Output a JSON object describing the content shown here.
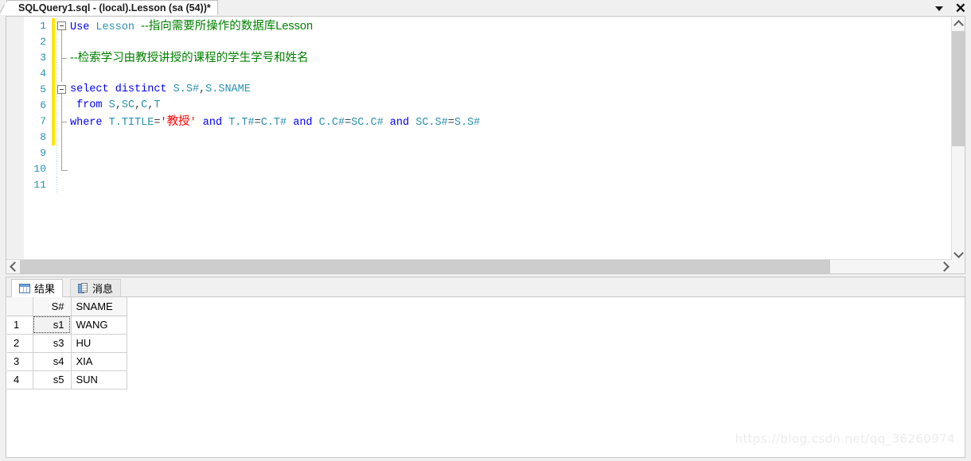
{
  "window": {
    "tab_title": "SQLQuery1.sql - (local).Lesson (sa (54))*",
    "dropdown_icon": "chevron-down-icon",
    "close_icon": "close-icon"
  },
  "editor": {
    "line_numbers": [
      "1",
      "2",
      "3",
      "4",
      "5",
      "6",
      "7",
      "8",
      "9",
      "10",
      "11"
    ],
    "lines": [
      {
        "n": "1",
        "tokens": [
          {
            "t": "Use",
            "c": "kw"
          },
          {
            "t": " ",
            "c": "plain"
          },
          {
            "t": "Lesson",
            "c": "ident"
          },
          {
            "t": " ",
            "c": "plain"
          },
          {
            "t": "--指向需要所操作的数据库Lesson",
            "c": "cmt"
          }
        ]
      },
      {
        "n": "2",
        "tokens": []
      },
      {
        "n": "3",
        "tokens": [
          {
            "t": "--检索学习由教授讲授的课程的学生学号和姓名",
            "c": "cmt"
          }
        ]
      },
      {
        "n": "4",
        "tokens": []
      },
      {
        "n": "5",
        "tokens": [
          {
            "t": "select",
            "c": "kw"
          },
          {
            "t": " ",
            "c": "plain"
          },
          {
            "t": "distinct",
            "c": "kw"
          },
          {
            "t": " ",
            "c": "plain"
          },
          {
            "t": "S.S#",
            "c": "ident"
          },
          {
            "t": ",",
            "c": "op"
          },
          {
            "t": "S.SNAME",
            "c": "ident"
          }
        ]
      },
      {
        "n": "6",
        "tokens": [
          {
            "t": " ",
            "c": "plain"
          },
          {
            "t": "from",
            "c": "kw"
          },
          {
            "t": " ",
            "c": "plain"
          },
          {
            "t": "S",
            "c": "ident"
          },
          {
            "t": ",",
            "c": "op"
          },
          {
            "t": "SC",
            "c": "ident"
          },
          {
            "t": ",",
            "c": "op"
          },
          {
            "t": "C",
            "c": "ident"
          },
          {
            "t": ",",
            "c": "op"
          },
          {
            "t": "T",
            "c": "ident"
          }
        ]
      },
      {
        "n": "7",
        "tokens": [
          {
            "t": "where",
            "c": "kw"
          },
          {
            "t": " ",
            "c": "plain"
          },
          {
            "t": "T.TITLE",
            "c": "ident"
          },
          {
            "t": "=",
            "c": "op"
          },
          {
            "t": "'",
            "c": "str-q"
          },
          {
            "t": "教授",
            "c": "str"
          },
          {
            "t": "'",
            "c": "str-q"
          },
          {
            "t": " ",
            "c": "plain"
          },
          {
            "t": "and",
            "c": "kw"
          },
          {
            "t": " ",
            "c": "plain"
          },
          {
            "t": "T.T#",
            "c": "ident"
          },
          {
            "t": "=",
            "c": "op"
          },
          {
            "t": "C.T#",
            "c": "ident"
          },
          {
            "t": " ",
            "c": "plain"
          },
          {
            "t": "and",
            "c": "kw"
          },
          {
            "t": " ",
            "c": "plain"
          },
          {
            "t": "C.C#",
            "c": "ident"
          },
          {
            "t": "=",
            "c": "op"
          },
          {
            "t": "SC.C#",
            "c": "ident"
          },
          {
            "t": " ",
            "c": "plain"
          },
          {
            "t": "and",
            "c": "kw"
          },
          {
            "t": " ",
            "c": "plain"
          },
          {
            "t": "SC.S#",
            "c": "ident"
          },
          {
            "t": "=",
            "c": "op"
          },
          {
            "t": "S.S#",
            "c": "ident"
          }
        ]
      },
      {
        "n": "8",
        "tokens": []
      },
      {
        "n": "9",
        "tokens": []
      },
      {
        "n": "10",
        "tokens": []
      },
      {
        "n": "11",
        "tokens": []
      }
    ],
    "full_text": [
      "Use Lesson --指向需要所操作的数据库Lesson",
      "",
      "--检索学习由教授讲授的课程的学生学号和姓名",
      "",
      "select distinct S.S#,S.SNAME",
      " from S,SC,C,T",
      "where T.TITLE='教授' and T.T#=C.T# and C.C#=SC.C# and SC.S#=S.S#",
      "",
      "",
      "",
      ""
    ],
    "colors": {
      "keyword": "#0000ff",
      "identifier": "#2b91af",
      "comment": "#008000",
      "string": "#ff0000",
      "line_number": "#2b91af",
      "change_bar": "#ffe400"
    },
    "scroll": {
      "v_up_icon": "chevron-up-icon",
      "v_down_icon": "chevron-down-icon",
      "h_left_icon": "chevron-left-icon",
      "h_right_icon": "chevron-right-icon"
    }
  },
  "results": {
    "tabs": [
      {
        "label": "结果",
        "icon": "grid-icon",
        "active": true
      },
      {
        "label": "消息",
        "icon": "document-icon",
        "active": false
      }
    ],
    "grid": {
      "row_header": "",
      "columns": [
        "S#",
        "SNAME"
      ],
      "rows": [
        {
          "n": "1",
          "s": "s1",
          "name": "WANG"
        },
        {
          "n": "2",
          "s": "s3",
          "name": "HU"
        },
        {
          "n": "3",
          "s": "s4",
          "name": "XIA"
        },
        {
          "n": "4",
          "s": "s5",
          "name": "SUN"
        }
      ],
      "focused_cell": "s1"
    }
  },
  "watermark": {
    "text": "https://blog.csdn.net/qq_36260974"
  }
}
